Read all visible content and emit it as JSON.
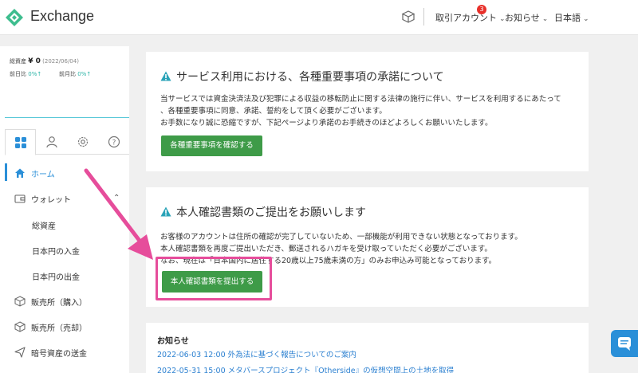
{
  "header": {
    "brand": "Exchange",
    "menus": [
      {
        "label": "取引アカウント",
        "badge": "3"
      },
      {
        "label": "お知らせ"
      },
      {
        "label": "日本語"
      }
    ],
    "icons": [
      "cube-icon",
      "chevron-down-icon"
    ]
  },
  "sidebar": {
    "total_assets_label": "総資産",
    "total_assets_value": "¥ 0",
    "total_assets_date": "(2022/06/04)",
    "prev_day_label": "前日比",
    "prev_day_value": "0%",
    "prev_month_label": "前月比",
    "prev_month_value": "0%",
    "tabs": [
      "grid-icon",
      "user-icon",
      "gear-icon",
      "help-icon"
    ],
    "nav": {
      "home": "ホーム",
      "wallet": "ウォレット",
      "wallet_sub": [
        "総資産",
        "日本円の入金",
        "日本円の出金"
      ],
      "buy": "販売所（購入）",
      "sell": "販売所（売却）",
      "send": "暗号資産の送金"
    }
  },
  "notice1": {
    "title": "サービス利用における、各種重要事項の承諾について",
    "lines": [
      "当サービスでは資金決済法及び犯罪による収益の移転防止に関する法律の施行に伴い、サービスを利用するにあたって",
      "、各種重要事項に同意、承諾、誓約をして頂く必要がございます。",
      "お手数になり誠に恐縮ですが、下記ページより承諾のお手続きのほどよろしくお願いいたします。"
    ],
    "button": "各種重要事項を確認する"
  },
  "notice2": {
    "title": "本人確認書類のご提出をお願いします",
    "lines": [
      "お客様のアカウントは住所の確認が完了していないため、一部機能が利用できない状態となっております。",
      "本人確認書類を再度ご提出いただき、郵送されるハガキを受け取っていただく必要がございます。",
      "なお、現在は「日本国内に居住する20歳以上75歳未満の方」のみお申込み可能となっております。"
    ],
    "button": "本人確認書類を提出する"
  },
  "news": {
    "title": "お知らせ",
    "items": [
      "2022-06-03 12:00 外為法に基づく報告についてのご案内",
      "2022-05-31 15:00 メタバースプロジェクト『Otherside』の仮想空間上の土地を取得"
    ]
  },
  "colors": {
    "accent_green": "#3e9b48",
    "link_blue": "#2a7fd0",
    "highlight_pink": "#e64d9b",
    "teal": "#2ab3a6"
  }
}
